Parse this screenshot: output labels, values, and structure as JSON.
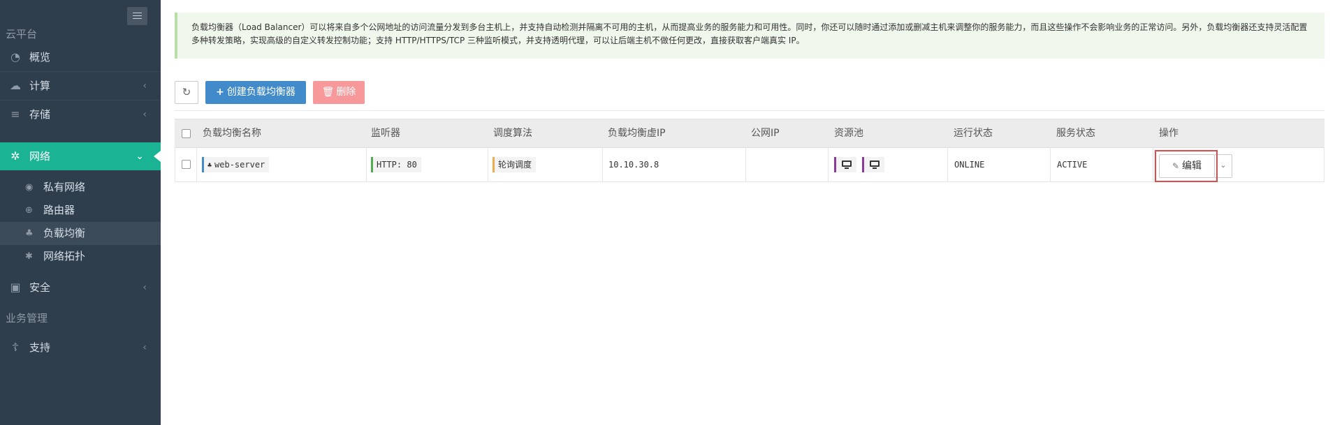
{
  "sidebar": {
    "section_cloud": "云平台",
    "section_business": "业务管理",
    "items": [
      {
        "label": "概览",
        "icon": "dashboard-icon"
      },
      {
        "label": "计算",
        "icon": "cloud-icon"
      },
      {
        "label": "存储",
        "icon": "database-icon"
      },
      {
        "label": "网络",
        "icon": "network-icon"
      },
      {
        "label": "安全",
        "icon": "security-icon"
      },
      {
        "label": "支持",
        "icon": "support-icon"
      }
    ],
    "network_sub": [
      {
        "label": "私有网络",
        "icon": "rss-icon"
      },
      {
        "label": "路由器",
        "icon": "globe-icon"
      },
      {
        "label": "负载均衡",
        "icon": "sitemap-icon"
      },
      {
        "label": "网络拓扑",
        "icon": "topology-icon"
      }
    ]
  },
  "info_text": "负载均衡器（Load Balancer）可以将来自多个公网地址的访问流量分发到多台主机上，并支持自动检测并隔离不可用的主机，从而提高业务的服务能力和可用性。同时，你还可以随时通过添加或删减主机来调整你的服务能力，而且这些操作不会影响业务的正常访问。另外，负载均衡器还支持灵活配置多种转发策略，实现高级的自定义转发控制功能；支持 HTTP/HTTPS/TCP 三种监听模式，并支持透明代理，可以让后端主机不做任何更改，直接获取客户端真实 IP。",
  "toolbar": {
    "create_label": "创建负载均衡器",
    "delete_label": "删除"
  },
  "table": {
    "headers": [
      "负载均衡名称",
      "监听器",
      "调度算法",
      "负载均衡虚IP",
      "公网IP",
      "资源池",
      "运行状态",
      "服务状态",
      "操作"
    ],
    "rows": [
      {
        "name": "web-server",
        "listener": "HTTP: 80",
        "algorithm": "轮询调度",
        "vip": "10.10.30.8",
        "public_ip": "",
        "run_status": "ONLINE",
        "service_status": "ACTIVE",
        "edit_label": "编辑"
      }
    ]
  },
  "colors": {
    "sidebar_bg": "#2f3e4d",
    "active_bg": "#1ab394",
    "primary": "#428bca",
    "danger": "#f7989a",
    "highlight": "#e04b4b"
  }
}
